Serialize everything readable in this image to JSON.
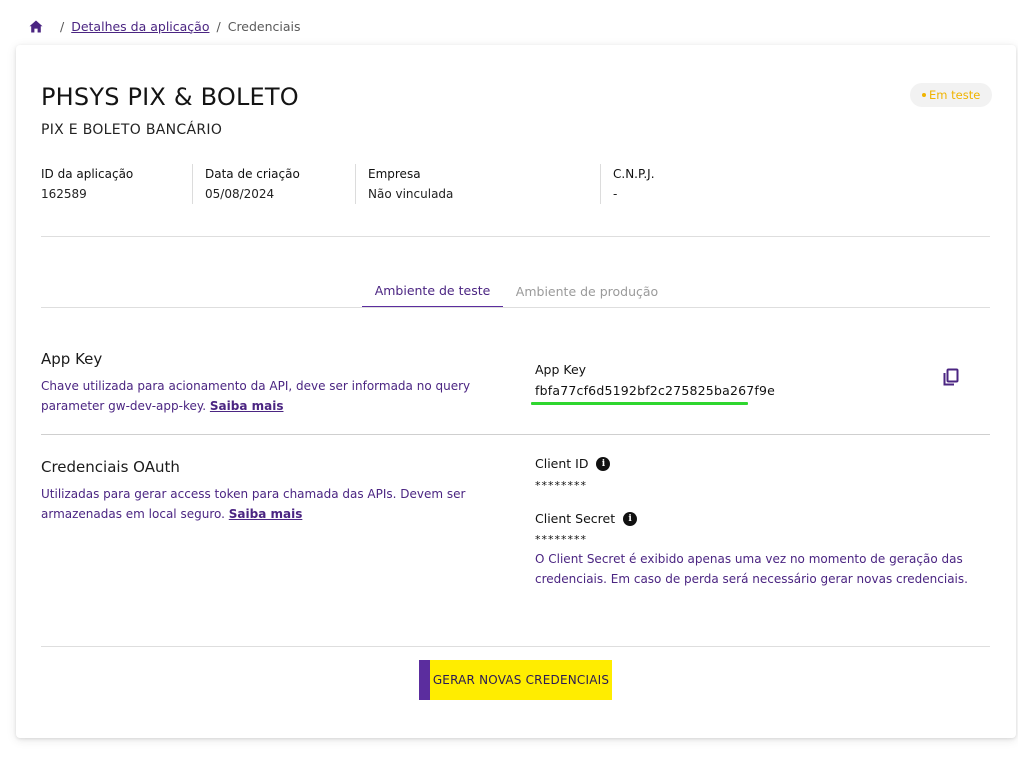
{
  "breadcrumb": {
    "home_icon": "home-icon",
    "separator": "/",
    "link": "Detalhes da aplicação",
    "current": "Credenciais"
  },
  "app": {
    "title": "PHSYS PIX & BOLETO",
    "subtitle": "PIX E BOLETO BANCÁRIO",
    "status": "Em teste"
  },
  "info": {
    "id_label": "ID da aplicação",
    "id_value": "162589",
    "date_label": "Data de criação",
    "date_value": "05/08/2024",
    "company_label": "Empresa",
    "company_value": "Não vinculada",
    "cnpj_label": "C.N.P.J.",
    "cnpj_value": "-"
  },
  "tabs": [
    {
      "label": "Ambiente de teste",
      "active": true
    },
    {
      "label": "Ambiente de produção",
      "active": false
    }
  ],
  "app_key": {
    "title": "App Key",
    "desc": "Chave utilizada para acionamento da API, deve ser informada no query parameter gw-dev-app-key.",
    "link": "Saiba mais",
    "field_label": "App Key",
    "value": "fbfa77cf6d5192bf2c275825ba267f9e",
    "copy_icon": "copy-icon"
  },
  "oauth": {
    "title": "Credenciais OAuth",
    "desc": "Utilizadas para gerar access token para chamada das APIs. Devem ser armazenadas em local seguro.",
    "link": "Saiba mais",
    "client_id_label": "Client ID",
    "client_id_value": "********",
    "client_secret_label": "Client Secret",
    "client_secret_value": "********",
    "note": "O Client Secret é exibido apenas uma vez no momento de geração das credenciais. Em caso de perda será necessário gerar novas credenciais."
  },
  "button": {
    "label": "GERAR NOVAS CREDENCIAIS"
  },
  "colors": {
    "primary": "#5b2d9e",
    "accent": "#ffed00",
    "status": "#f0b400",
    "highlight": "#2fd62f"
  }
}
